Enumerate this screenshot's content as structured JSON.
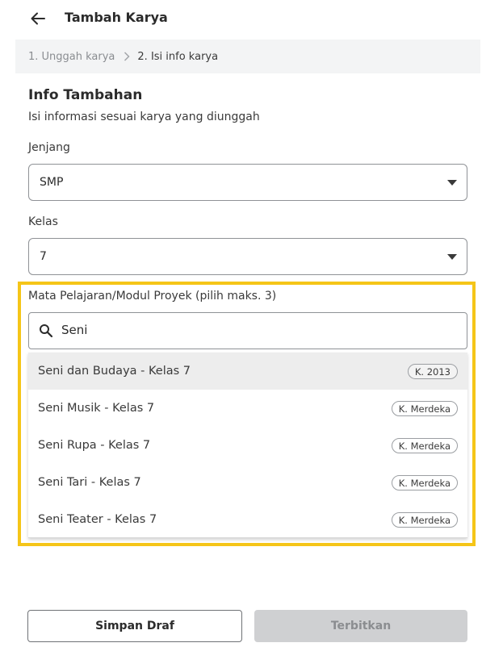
{
  "header": {
    "back_icon": "arrow-left-icon",
    "title": "Tambah Karya"
  },
  "breadcrumb": {
    "step1": "1. Unggah karya",
    "separator_icon": "chevron-right-icon",
    "step2": "2. Isi info karya"
  },
  "section": {
    "title": "Info Tambahan",
    "subtitle": "Isi informasi sesuai karya yang diunggah"
  },
  "jenjang": {
    "label": "Jenjang",
    "value": "SMP"
  },
  "kelas": {
    "label": "Kelas",
    "value": "7"
  },
  "subject": {
    "label": "Mata Pelajaran/Modul Proyek (pilih maks. 3)",
    "search_value": "Seni",
    "highlight_color": "#f5c518",
    "options": [
      {
        "label": "Seni dan Budaya - Kelas 7",
        "badge": "K. 2013",
        "selected": true
      },
      {
        "label": "Seni Musik - Kelas 7",
        "badge": "K. Merdeka",
        "selected": false
      },
      {
        "label": "Seni Rupa - Kelas 7",
        "badge": "K. Merdeka",
        "selected": false
      },
      {
        "label": "Seni Tari - Kelas 7",
        "badge": "K. Merdeka",
        "selected": false
      },
      {
        "label": "Seni Teater - Kelas 7",
        "badge": "K. Merdeka",
        "selected": false
      }
    ]
  },
  "actions": {
    "draft_label": "Simpan Draf",
    "publish_label": "Terbitkan",
    "publish_disabled": true
  }
}
